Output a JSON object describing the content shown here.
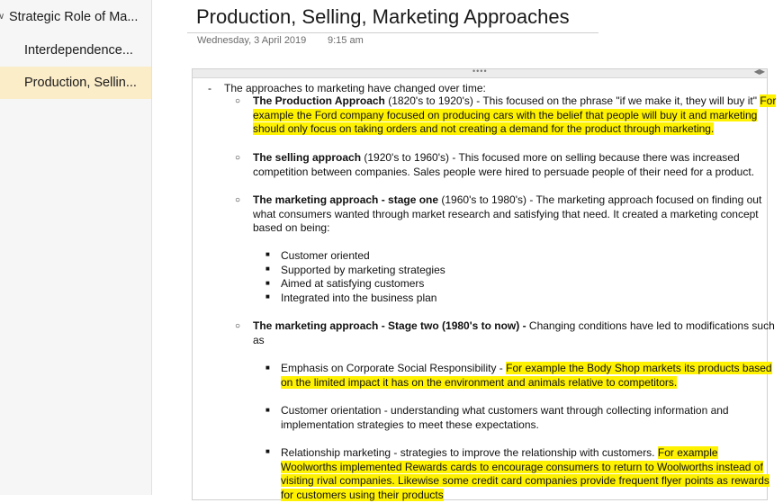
{
  "sidebar": {
    "items": [
      {
        "label": "Strategic Role of Ma..."
      },
      {
        "label": "Interdependence..."
      },
      {
        "label": "Production, Sellin..."
      }
    ]
  },
  "page": {
    "title": "Production, Selling, Marketing Approaches",
    "date": "Wednesday, 3 April 2019",
    "time": "9:15 am"
  },
  "note": {
    "intro": "The approaches to marketing have changed over time:",
    "production": {
      "bold": "The Production Approach",
      "l1_plain": " (1820's to 1920's) - This focused on the phrase \"if we make it, they will buy it\" ",
      "l1_hl": "For",
      "l2_hl": "example the Ford company focused on producing cars with the belief that people will buy it and marketing",
      "l3_hl": "should only focus on taking orders and not creating a demand for the product through marketing."
    },
    "selling": {
      "bold": "The selling approach",
      "l1_plain": " (1920's to 1960's) - This focused more on selling because there was increased",
      "l2": "competition between companies. Sales people were hired to persuade people of their need for a product."
    },
    "marketing1": {
      "bold": "The marketing approach - stage one",
      "l1_plain": " (1960's to 1980's) - The marketing approach focused on finding out",
      "l2": "what consumers wanted through market research and satisfying that need. It created a marketing concept",
      "l3": "based on being:",
      "items": [
        "Customer oriented",
        "Supported by marketing strategies",
        "Aimed at satisfying customers",
        "Integrated into the business plan"
      ]
    },
    "marketing2": {
      "bold": "The marketing approach - Stage two (1980's to now) -",
      "l1_plain": " Changing conditions have led to modifications such",
      "l2": "as",
      "csr": {
        "plain": "Emphasis on Corporate Social Responsibility - ",
        "hl1": "For example the Body Shop markets its products based",
        "hl2": "on the limited impact it has on the environment and animals relative to competitors."
      },
      "orientation": {
        "l1": "Customer orientation -  understanding what customers want through collecting information and",
        "l2": "implementation strategies to meet these expectations."
      },
      "relationship": {
        "plain": "Relationship marketing - strategies to improve the relationship with customers. ",
        "hl1": "For example",
        "hl2": "Woolworths implemented Rewards cards to encourage consumers to return to Woolworths instead of",
        "hl3": "visiting rival companies. Likewise some credit card companies provide frequent flyer points as rewards",
        "hl4": "for customers using their products"
      }
    }
  },
  "colors": {
    "highlight": "#fff200",
    "selected_page": "#fcedc9"
  },
  "icons": {
    "collapse": "chevron-down-icon",
    "grip": "drag-grip-icon",
    "resize": "resize-arrows-icon"
  }
}
